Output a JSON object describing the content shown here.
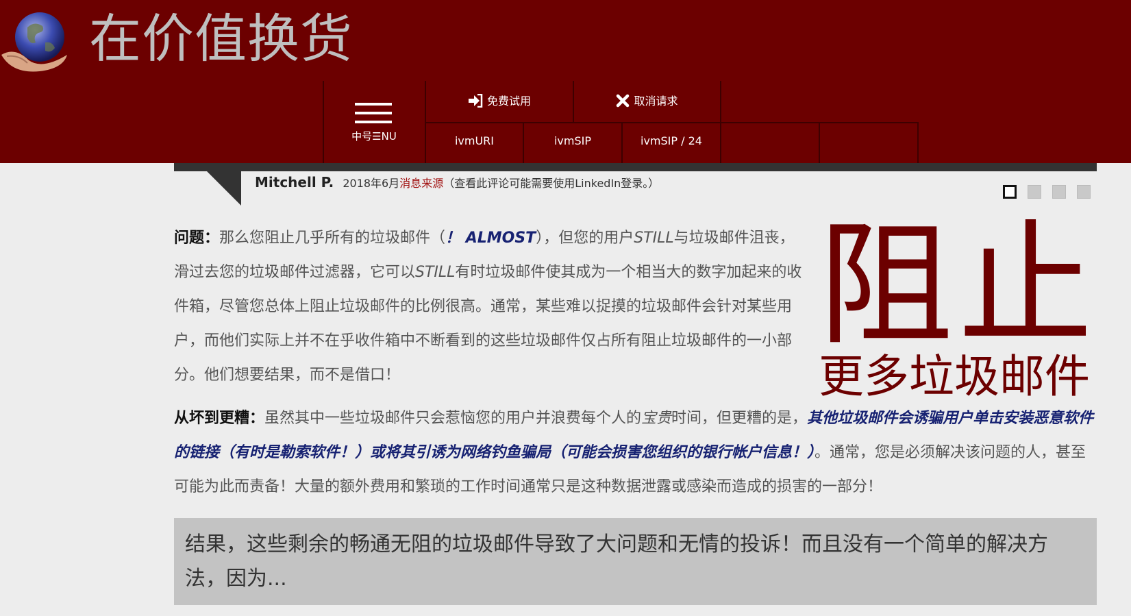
{
  "header": {
    "site_title": "在价值换货",
    "menu_label": "中号☰NU",
    "nav": {
      "free_trial": "免费试用",
      "cancel_request": "取消请求",
      "tab1": "ivmURI",
      "tab2": "ivmSIP",
      "tab3": "ivmSIP / 24"
    },
    "icons": {
      "logo": "globe-in-hands",
      "menu": "hamburger-icon",
      "signin": "sign-in-icon",
      "cancel": "close-icon"
    }
  },
  "testimonial": {
    "name": "Mitchell P.",
    "date": "2018年6月",
    "source_link": "消息来源",
    "note": "（查看此评论可能需要使用LinkedIn登录。）",
    "slides_total": 4,
    "slide_active": 1
  },
  "content": {
    "p1": {
      "label": "问题：",
      "t1": "那么您阻止几乎所有的垃圾邮件（",
      "almost": "！ ALMOST",
      "t2": "），但您的用户",
      "still1": "STILL",
      "t3": "与垃圾邮件沮丧，滑过去您的垃圾邮件过滤器，它可以",
      "still2": "STILL",
      "t4": "有时垃圾邮件使其成为一个相当大的数字加起来的收件箱，尽管您总体上阻止垃圾邮件的比例很高。通常，某些难以捉摸的垃圾邮件会针对某些用户，而他们实际上并不在乎收件箱中不断看到的这些垃圾邮件仅占所有阻止垃圾邮件的一小部分。他们想要结果，而不是借口！"
    },
    "p2": {
      "label": "从坏到更糟：",
      "t1": "虽然其中一些垃圾邮件只会惹恼您的用户并浪费每个人的",
      "precious": "宝贵",
      "t2": "时间，但更糟的是，",
      "highlight": "其他垃圾邮件会诱骗用户单击安装恶意软件的链接（有时是勒索软件！）或将其引诱为网络钓鱼骗局（可能会损害您组织的银行帐户信息！）",
      "t3": "。通常，您是必须解决该问题的人，甚至可能为此而责备！大量的额外费用和繁琐的工作时间通常只是这种数据泄露或感染而造成的损害的一部分！"
    },
    "big_title": "阻止",
    "big_subtitle": "更多垃圾邮件",
    "result_box": "结果，这些剩余的畅通无阻的垃圾邮件导致了大问题和无情的投诉！而且没有一个简单的解决方法，因为..."
  },
  "colors": {
    "brand": "#6c0000",
    "highlight": "#172272",
    "link": "#a11111",
    "box": "#c3c3c3"
  }
}
